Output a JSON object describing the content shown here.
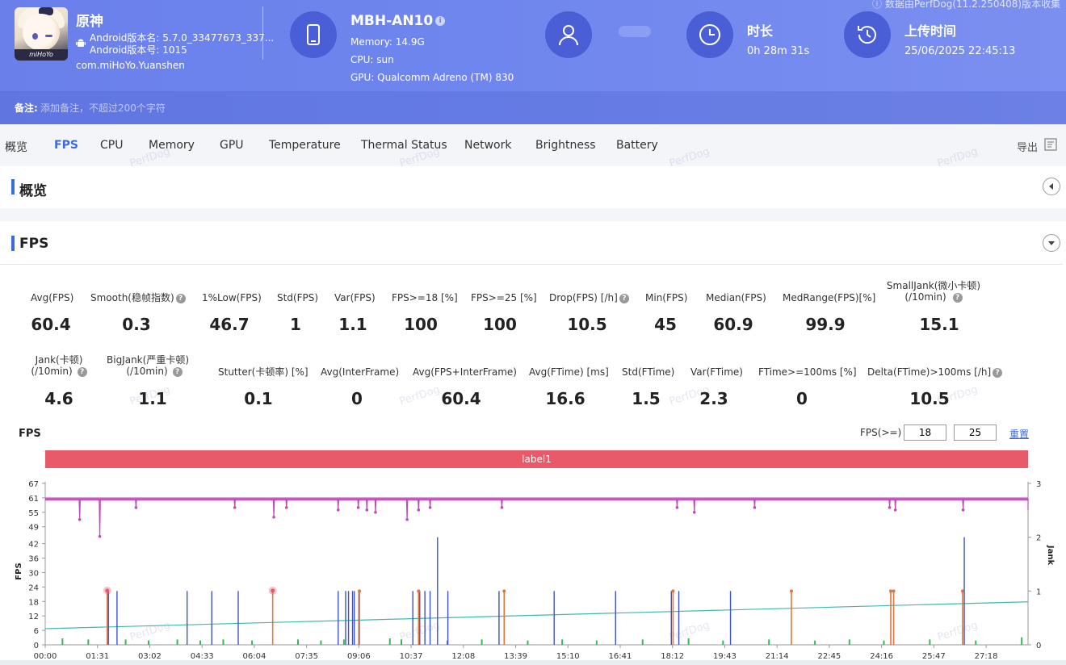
{
  "app": {
    "name": "原神",
    "version_name": "Android版本名: 5.7.0_33477673_337...",
    "version_code": "Android版本号: 1015",
    "package": "com.miHoYo.Yuanshen",
    "icon_logo": "miHoYo"
  },
  "device": {
    "name": "MBH-AN10",
    "memory": "Memory: 14.9G",
    "cpu": "CPU: sun",
    "gpu": "GPU: Qualcomm Adreno (TM) 830"
  },
  "duration": {
    "title": "时长",
    "value": "0h 28m 31s"
  },
  "upload": {
    "title": "上传时间",
    "value": "25/06/2025 22:45:13"
  },
  "collect_note": "ⓘ 数据由PerfDog(11.2.250408)版本收集",
  "note": {
    "label": "备注:",
    "placeholder": "添加备注，不超过200个字符"
  },
  "tabs": [
    "概览",
    "FPS",
    "CPU",
    "Memory",
    "GPU",
    "Temperature",
    "Thermal Status",
    "Network",
    "Brightness",
    "Battery"
  ],
  "export_label": "导出",
  "watermark": "PerfDog",
  "sections": {
    "overview": "概览",
    "fps": "FPS"
  },
  "metrics_row1": [
    {
      "label": "Avg(FPS)",
      "value": "60.4"
    },
    {
      "label": "Smooth(稳帧指数)",
      "value": "0.3"
    },
    {
      "label": "1%Low(FPS)",
      "value": "46.7"
    },
    {
      "label": "Std(FPS)",
      "value": "1"
    },
    {
      "label": "Var(FPS)",
      "value": "1.1"
    },
    {
      "label": "FPS>=18 [%]",
      "value": "100"
    },
    {
      "label": "FPS>=25 [%]",
      "value": "100"
    },
    {
      "label": "Drop(FPS) [/h]",
      "value": "10.5"
    },
    {
      "label": "Min(FPS)",
      "value": "45"
    },
    {
      "label": "Median(FPS)",
      "value": "60.9"
    },
    {
      "label": "MedRange(FPS)[%]",
      "value": "99.9"
    },
    {
      "label": "SmallJank(微小卡顿)",
      "label2": "(/10min)",
      "value": "15.1"
    }
  ],
  "metrics_row2": [
    {
      "label": "Jank(卡顿)",
      "label2": "(/10min)",
      "value": "4.6"
    },
    {
      "label": "BigJank(严重卡顿)",
      "label2": "(/10min)",
      "value": "1.1"
    },
    {
      "label": "Stutter(卡顿率) [%]",
      "value": "0.1"
    },
    {
      "label": "Avg(InterFrame)",
      "value": "0"
    },
    {
      "label": "Avg(FPS+InterFrame)",
      "value": "60.4"
    },
    {
      "label": "Avg(FTime) [ms]",
      "value": "16.6"
    },
    {
      "label": "Std(FTime)",
      "value": "1.5"
    },
    {
      "label": "Var(FTime)",
      "value": "2.3"
    },
    {
      "label": "FTime>=100ms [%]",
      "value": "0"
    },
    {
      "label": "Delta(FTime)>100ms [/h]",
      "value": "10.5"
    }
  ],
  "chart_controls": {
    "title": "FPS",
    "fps_ge_label": "FPS(>=)",
    "threshold1": "18",
    "threshold2": "25",
    "reset_label": "重置",
    "label_name": "label1"
  },
  "colors": {
    "accent": "#3d6bd8",
    "header": "#6a7fea",
    "fps_line": "#c04ab8",
    "jank": "#4052c8",
    "bigjank": "#e5733a",
    "smalljank": "#3cb45a",
    "stutter_line": "#3fb8b0",
    "label_bar": "#e85a6a"
  },
  "chart_data": {
    "type": "line",
    "title": "FPS",
    "ylabel": "FPS",
    "y2label": "Jank",
    "y_ticks": [
      0,
      6,
      12,
      18,
      24,
      30,
      36,
      42,
      49,
      55,
      61,
      67
    ],
    "y2_ticks": [
      0,
      1,
      2,
      3
    ],
    "ylim": [
      0,
      67
    ],
    "y2lim": [
      0,
      3
    ],
    "x_ticks": [
      "00:00",
      "01:31",
      "03:02",
      "04:33",
      "06:04",
      "07:35",
      "09:06",
      "10:37",
      "12:08",
      "13:39",
      "15:10",
      "16:41",
      "18:12",
      "19:43",
      "21:14",
      "22:45",
      "24:16",
      "25:47",
      "27:18"
    ],
    "duration_s": 1711,
    "fps_baseline": 60.5,
    "fps_dips": [
      {
        "t": 60,
        "fps": 52
      },
      {
        "t": 95,
        "fps": 45
      },
      {
        "t": 158,
        "fps": 57
      },
      {
        "t": 330,
        "fps": 57
      },
      {
        "t": 398,
        "fps": 53
      },
      {
        "t": 420,
        "fps": 57
      },
      {
        "t": 510,
        "fps": 56
      },
      {
        "t": 545,
        "fps": 57
      },
      {
        "t": 560,
        "fps": 56
      },
      {
        "t": 575,
        "fps": 55
      },
      {
        "t": 630,
        "fps": 52
      },
      {
        "t": 650,
        "fps": 56
      },
      {
        "t": 670,
        "fps": 57
      },
      {
        "t": 795,
        "fps": 57
      },
      {
        "t": 1100,
        "fps": 57
      },
      {
        "t": 1130,
        "fps": 55
      },
      {
        "t": 1235,
        "fps": 57
      },
      {
        "t": 1470,
        "fps": 57
      },
      {
        "t": 1480,
        "fps": 56
      },
      {
        "t": 1598,
        "fps": 56
      }
    ],
    "jank_events": [
      {
        "t": 110,
        "v": 1
      },
      {
        "t": 125,
        "v": 1
      },
      {
        "t": 247,
        "v": 1
      },
      {
        "t": 290,
        "v": 1
      },
      {
        "t": 336,
        "v": 1
      },
      {
        "t": 510,
        "v": 1
      },
      {
        "t": 523,
        "v": 1
      },
      {
        "t": 528,
        "v": 1
      },
      {
        "t": 535,
        "v": 1
      },
      {
        "t": 538,
        "v": 1
      },
      {
        "t": 546,
        "v": 1
      },
      {
        "t": 640,
        "v": 1
      },
      {
        "t": 652,
        "v": 1
      },
      {
        "t": 661,
        "v": 1
      },
      {
        "t": 670,
        "v": 1
      },
      {
        "t": 683,
        "v": 2
      },
      {
        "t": 701,
        "v": 1
      },
      {
        "t": 790,
        "v": 1
      },
      {
        "t": 886,
        "v": 1
      },
      {
        "t": 993,
        "v": 1
      },
      {
        "t": 1090,
        "v": 1
      },
      {
        "t": 1103,
        "v": 1
      },
      {
        "t": 1193,
        "v": 1
      },
      {
        "t": 1600,
        "v": 2
      }
    ],
    "bigjank_events": [
      {
        "t": 108,
        "v": 1
      },
      {
        "t": 396,
        "v": 1
      },
      {
        "t": 547,
        "v": 1
      },
      {
        "t": 650,
        "v": 1
      },
      {
        "t": 799,
        "v": 1
      },
      {
        "t": 1093,
        "v": 1
      },
      {
        "t": 1299,
        "v": 1
      },
      {
        "t": 1472,
        "v": 1
      },
      {
        "t": 1477,
        "v": 1
      },
      {
        "t": 1597,
        "v": 1
      }
    ],
    "smalljank_events": [
      {
        "t": 30,
        "v": 0.12
      },
      {
        "t": 75,
        "v": 0.1
      },
      {
        "t": 140,
        "v": 0.1
      },
      {
        "t": 180,
        "v": 0.08
      },
      {
        "t": 230,
        "v": 0.1
      },
      {
        "t": 270,
        "v": 0.08
      },
      {
        "t": 310,
        "v": 0.1
      },
      {
        "t": 360,
        "v": 0.08
      },
      {
        "t": 440,
        "v": 0.1
      },
      {
        "t": 480,
        "v": 0.08
      },
      {
        "t": 520,
        "v": 0.1
      },
      {
        "t": 600,
        "v": 0.12
      },
      {
        "t": 620,
        "v": 0.1
      },
      {
        "t": 700,
        "v": 0.08
      },
      {
        "t": 760,
        "v": 0.1
      },
      {
        "t": 840,
        "v": 0.08
      },
      {
        "t": 900,
        "v": 0.1
      },
      {
        "t": 960,
        "v": 0.08
      },
      {
        "t": 1040,
        "v": 0.1
      },
      {
        "t": 1120,
        "v": 0.12
      },
      {
        "t": 1180,
        "v": 0.08
      },
      {
        "t": 1260,
        "v": 0.1
      },
      {
        "t": 1340,
        "v": 0.08
      },
      {
        "t": 1400,
        "v": 0.1
      },
      {
        "t": 1460,
        "v": 0.08
      },
      {
        "t": 1540,
        "v": 0.1
      },
      {
        "t": 1620,
        "v": 0.08
      },
      {
        "t": 1700,
        "v": 0.14
      }
    ],
    "stutter_trend": [
      {
        "t": 0,
        "v": 0.3
      },
      {
        "t": 1711,
        "v": 0.8
      }
    ],
    "highlight_points": [
      {
        "t": 108,
        "fps": 22.5
      },
      {
        "t": 396,
        "fps": 22.5
      }
    ],
    "grid": false
  }
}
